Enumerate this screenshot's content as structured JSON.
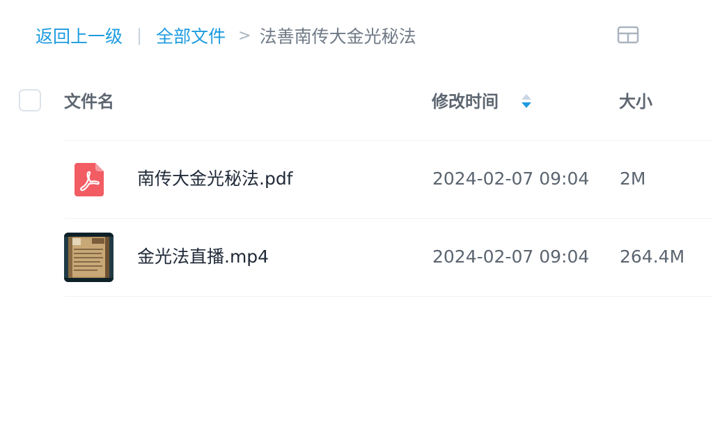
{
  "breadcrumb": {
    "back_label": "返回上一级",
    "separator": "|",
    "root_label": "全部文件",
    "arrow": ">",
    "current_label": "法善南传大金光秘法"
  },
  "view_toggle": {
    "icon": "grid-view-icon"
  },
  "table": {
    "headers": {
      "name": "文件名",
      "modified": "修改时间",
      "size": "大小"
    },
    "sort": {
      "column": "modified",
      "direction": "desc",
      "icon": "sort-icon"
    },
    "rows": [
      {
        "icon": "pdf-icon",
        "name": "南传大金光秘法.pdf",
        "modified": "2024-02-07 09:04",
        "size": "2M"
      },
      {
        "icon": "video-thumbnail",
        "name": "金光法直播.mp4",
        "modified": "2024-02-07 09:04",
        "size": "264.4M"
      }
    ]
  },
  "colors": {
    "link": "#1d9be0",
    "pdf_red": "#f25c63",
    "sort_active": "#1d9be0",
    "sort_inactive": "#c9d6e3"
  }
}
